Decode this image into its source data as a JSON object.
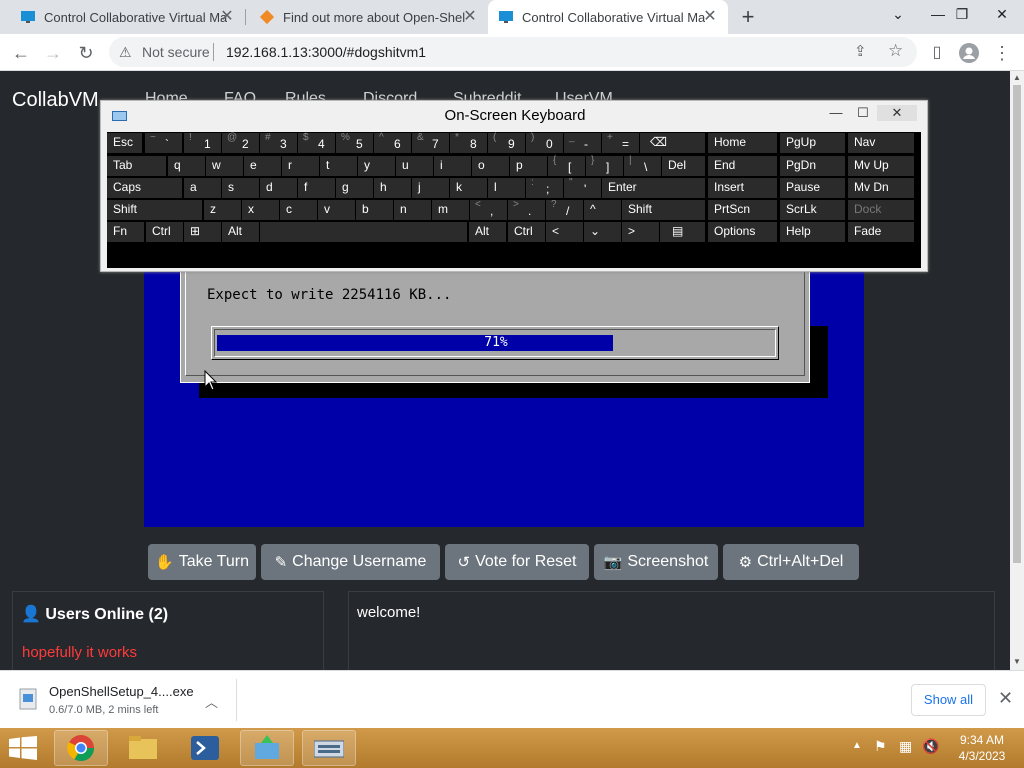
{
  "browser": {
    "tabs": [
      {
        "title": "Control Collaborative Virtual Ma",
        "active": false
      },
      {
        "title": "Find out more about Open-Shell",
        "active": false
      },
      {
        "title": "Control Collaborative Virtual Ma",
        "active": true
      }
    ],
    "new_tab": "+",
    "address": {
      "security": "Not secure",
      "url": "192.168.1.13:3000/#dogshitvm1"
    }
  },
  "site": {
    "brand": "CollabVM",
    "nav": [
      "Home",
      "FAQ",
      "Rules",
      "Discord",
      "Subreddit",
      "UserVM"
    ]
  },
  "osk": {
    "title": "On-Screen Keyboard",
    "rows": [
      [
        {
          "l": "Esc"
        },
        {
          "s": "~",
          "m": "`"
        },
        {
          "s": "!",
          "m": "1"
        },
        {
          "s": "@",
          "m": "2"
        },
        {
          "s": "#",
          "m": "3"
        },
        {
          "s": "$",
          "m": "4"
        },
        {
          "s": "%",
          "m": "5"
        },
        {
          "s": "^",
          "m": "6"
        },
        {
          "s": "&",
          "m": "7"
        },
        {
          "s": "*",
          "m": "8"
        },
        {
          "s": "(",
          "m": "9"
        },
        {
          "s": ")",
          "m": "0"
        },
        {
          "s": "_",
          "m": "-"
        },
        {
          "s": "+",
          "m": "="
        },
        {
          "l": "⌫"
        },
        {
          "l": "Home"
        },
        {
          "l": "PgUp"
        },
        {
          "l": "Nav"
        }
      ],
      [
        {
          "l": "Tab"
        },
        {
          "l": "q"
        },
        {
          "l": "w"
        },
        {
          "l": "e"
        },
        {
          "l": "r"
        },
        {
          "l": "t"
        },
        {
          "l": "y"
        },
        {
          "l": "u"
        },
        {
          "l": "i"
        },
        {
          "l": "o"
        },
        {
          "l": "p"
        },
        {
          "s": "{",
          "m": "["
        },
        {
          "s": "}",
          "m": "]"
        },
        {
          "s": "|",
          "m": "\\"
        },
        {
          "l": "Del"
        },
        {
          "l": "End"
        },
        {
          "l": "PgDn"
        },
        {
          "l": "Mv Up"
        }
      ],
      [
        {
          "l": "Caps"
        },
        {
          "l": "a"
        },
        {
          "l": "s"
        },
        {
          "l": "d"
        },
        {
          "l": "f"
        },
        {
          "l": "g"
        },
        {
          "l": "h"
        },
        {
          "l": "j"
        },
        {
          "l": "k"
        },
        {
          "l": "l"
        },
        {
          "s": ":",
          "m": ";"
        },
        {
          "s": "\"",
          "m": "'"
        },
        {
          "l": "Enter"
        },
        {
          "l": "Insert"
        },
        {
          "l": "Pause"
        },
        {
          "l": "Mv Dn"
        }
      ],
      [
        {
          "l": "Shift"
        },
        {
          "l": "z"
        },
        {
          "l": "x"
        },
        {
          "l": "c"
        },
        {
          "l": "v"
        },
        {
          "l": "b"
        },
        {
          "l": "n"
        },
        {
          "l": "m"
        },
        {
          "s": "<",
          "m": ","
        },
        {
          "s": ">",
          "m": "."
        },
        {
          "s": "?",
          "m": "/"
        },
        {
          "l": "^"
        },
        {
          "l": "Shift"
        },
        {
          "l": "PrtScn"
        },
        {
          "l": "ScrLk"
        },
        {
          "l": "Dock"
        }
      ],
      [
        {
          "l": "Fn"
        },
        {
          "l": "Ctrl"
        },
        {
          "l": "win"
        },
        {
          "l": "Alt"
        },
        {
          "l": ""
        },
        {
          "l": "Alt"
        },
        {
          "l": "Ctrl"
        },
        {
          "l": "<"
        },
        {
          "l": "v"
        },
        {
          "l": ">"
        },
        {
          "l": "menu"
        },
        {
          "l": "Options"
        },
        {
          "l": "Help"
        },
        {
          "l": "Fade"
        }
      ]
    ]
  },
  "vm": {
    "expect_text": "Expect to write 2254116 KB...",
    "progress": 0.71,
    "progress_label": "71%"
  },
  "buttons": {
    "take_turn": "Take Turn",
    "change_username": "Change Username",
    "vote_reset": "Vote for Reset",
    "screenshot": "Screenshot",
    "ctrl_alt_del": "Ctrl+Alt+Del"
  },
  "users": {
    "header": "Users Online (2)",
    "message": "hopefully it works"
  },
  "chat": {
    "message": "welcome!"
  },
  "download": {
    "file": "OpenShellSetup_4....exe",
    "status": "0.6/7.0 MB, 2 mins left",
    "show_all": "Show all"
  },
  "taskbar": {
    "time": "9:34 AM",
    "date": "4/3/2023"
  },
  "colors": {
    "vm_blue": "#0000a8",
    "error_red": "#ff3a3a",
    "page_bg": "#25282c",
    "button_gray": "#6c757d"
  }
}
